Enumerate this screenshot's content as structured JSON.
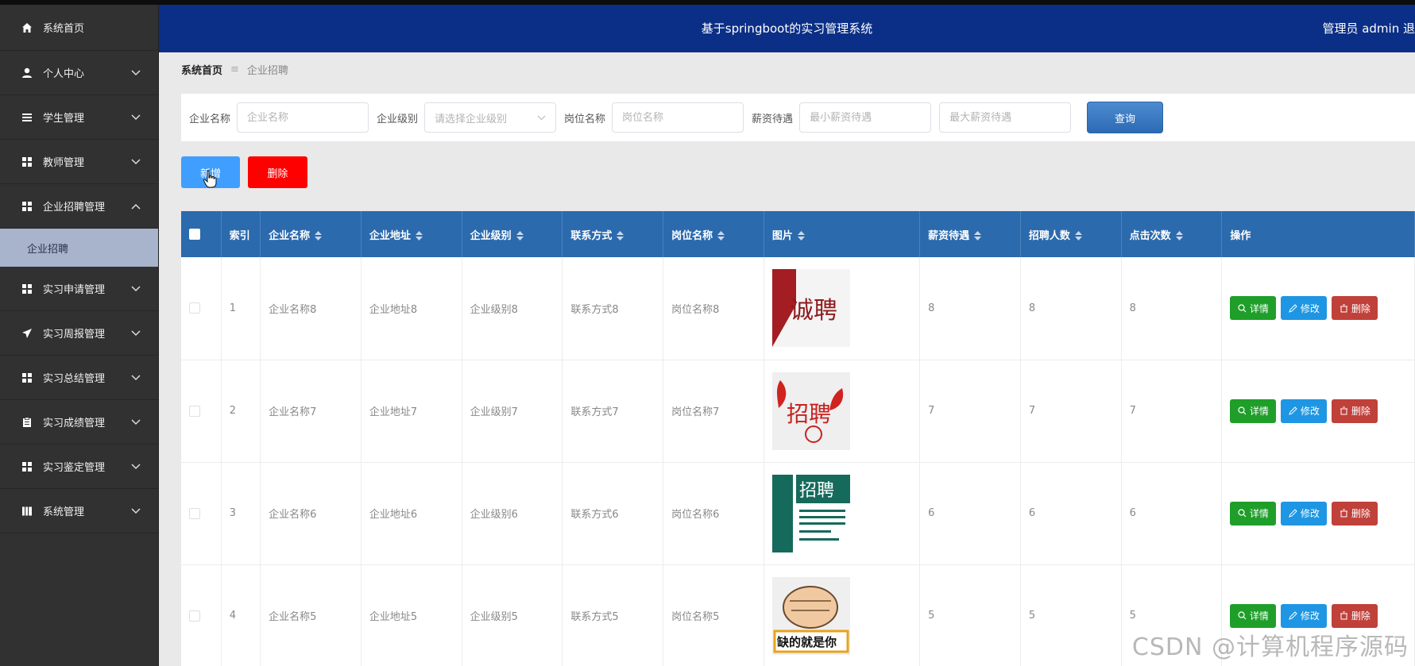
{
  "header": {
    "title": "基于springboot的实习管理系统",
    "user": "管理员 admin  退"
  },
  "sidebar": {
    "items": [
      {
        "label": "系统首页",
        "icon": "home-icon"
      },
      {
        "label": "个人中心",
        "icon": "user-icon"
      },
      {
        "label": "学生管理",
        "icon": "list-icon"
      },
      {
        "label": "教师管理",
        "icon": "grid-icon"
      },
      {
        "label": "企业招聘管理",
        "icon": "grid-icon",
        "expanded": true,
        "children": [
          {
            "label": "企业招聘",
            "active": true
          }
        ]
      },
      {
        "label": "实习申请管理",
        "icon": "grid-icon"
      },
      {
        "label": "实习周报管理",
        "icon": "send-icon"
      },
      {
        "label": "实习总结管理",
        "icon": "grid-icon"
      },
      {
        "label": "实习成绩管理",
        "icon": "clipboard-icon"
      },
      {
        "label": "实习鉴定管理",
        "icon": "grid-icon"
      },
      {
        "label": "系统管理",
        "icon": "book-icon"
      }
    ]
  },
  "breadcrumb": {
    "home": "系统首页",
    "separator": "≡",
    "current": "企业招聘"
  },
  "search": {
    "company_label": "企业名称",
    "company_placeholder": "企业名称",
    "level_label": "企业级别",
    "level_placeholder": "请选择企业级别",
    "position_label": "岗位名称",
    "position_placeholder": "岗位名称",
    "salary_label": "薪资待遇",
    "salary_min_placeholder": "最小薪资待遇",
    "salary_max_placeholder": "最大薪资待遇",
    "query_button": "查询"
  },
  "actions": {
    "add": "新增",
    "delete": "删除"
  },
  "table": {
    "columns": [
      "索引",
      "企业名称",
      "企业地址",
      "企业级别",
      "联系方式",
      "岗位名称",
      "图片",
      "薪资待遇",
      "招聘人数",
      "点击次数",
      "操作"
    ],
    "rows": [
      {
        "index": "1",
        "company": "企业名称8",
        "address": "企业地址8",
        "level": "企业级别8",
        "contact": "联系方式8",
        "position": "岗位名称8",
        "image": "诚聘",
        "salary": "8",
        "hires": "8",
        "clicks": "8"
      },
      {
        "index": "2",
        "company": "企业名称7",
        "address": "企业地址7",
        "level": "企业级别7",
        "contact": "联系方式7",
        "position": "岗位名称7",
        "image": "招聘",
        "salary": "7",
        "hires": "7",
        "clicks": "7"
      },
      {
        "index": "3",
        "company": "企业名称6",
        "address": "企业地址6",
        "level": "企业级别6",
        "contact": "联系方式6",
        "position": "岗位名称6",
        "image": "招聘",
        "salary": "6",
        "hires": "6",
        "clicks": "6"
      },
      {
        "index": "4",
        "company": "企业名称5",
        "address": "企业地址5",
        "level": "企业级别5",
        "contact": "联系方式5",
        "position": "岗位名称5",
        "image": "缺的就是你",
        "salary": "5",
        "hires": "5",
        "clicks": "5"
      }
    ],
    "row_actions": {
      "detail": "详情",
      "edit": "修改",
      "delete": "删除"
    }
  },
  "watermark": "CSDN @计算机程序源码",
  "colors": {
    "sidebar_bg": "#313131",
    "header_bg": "#0b2f86",
    "table_header_bg": "#2b6aad",
    "add_button": "#409eff",
    "delete_button": "#ff0000"
  }
}
